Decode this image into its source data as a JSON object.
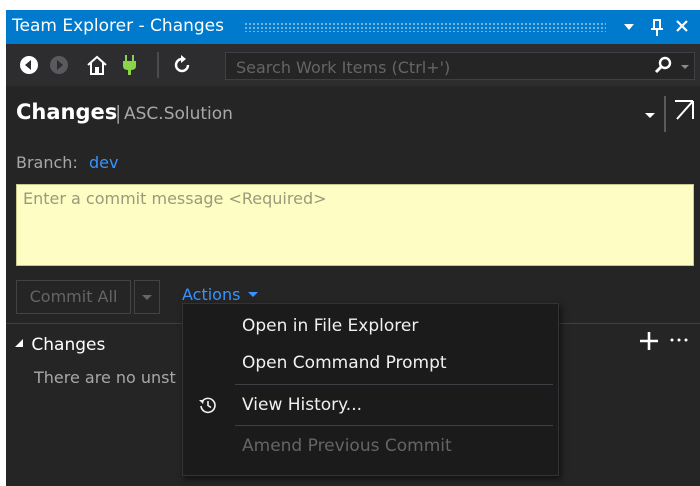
{
  "window": {
    "title": "Team Explorer - Changes",
    "controls": {
      "dropdown": "▾",
      "pin": "ᵮ",
      "close": "✕"
    }
  },
  "toolbar": {
    "icons": [
      "back-icon",
      "forward-icon",
      "home-icon",
      "connect-icon",
      "refresh-icon"
    ],
    "search_placeholder": "Search Work Items (Ctrl+')",
    "search_value": ""
  },
  "header": {
    "title": "Changes",
    "separator": "|",
    "subtitle": "ASC.Solution"
  },
  "branch": {
    "label": "Branch:",
    "value": "dev"
  },
  "commit": {
    "placeholder": "Enter a commit message <Required>",
    "value": "",
    "button_label": "Commit All",
    "actions_label": "Actions"
  },
  "changes_section": {
    "title": "Changes",
    "empty_text": "There are no unst"
  },
  "actions_menu": {
    "items": [
      {
        "label": "Open in File Explorer",
        "enabled": true
      },
      {
        "label": "Open Command Prompt",
        "enabled": true
      },
      {
        "label": "View History...",
        "enabled": true,
        "icon": "history-icon"
      },
      {
        "label": "Amend Previous Commit",
        "enabled": false
      }
    ]
  },
  "colors": {
    "accent": "#007acc",
    "background": "#252526",
    "link": "#3794ff",
    "commit_box": "#fefdc3",
    "disabled_text": "#656565"
  }
}
